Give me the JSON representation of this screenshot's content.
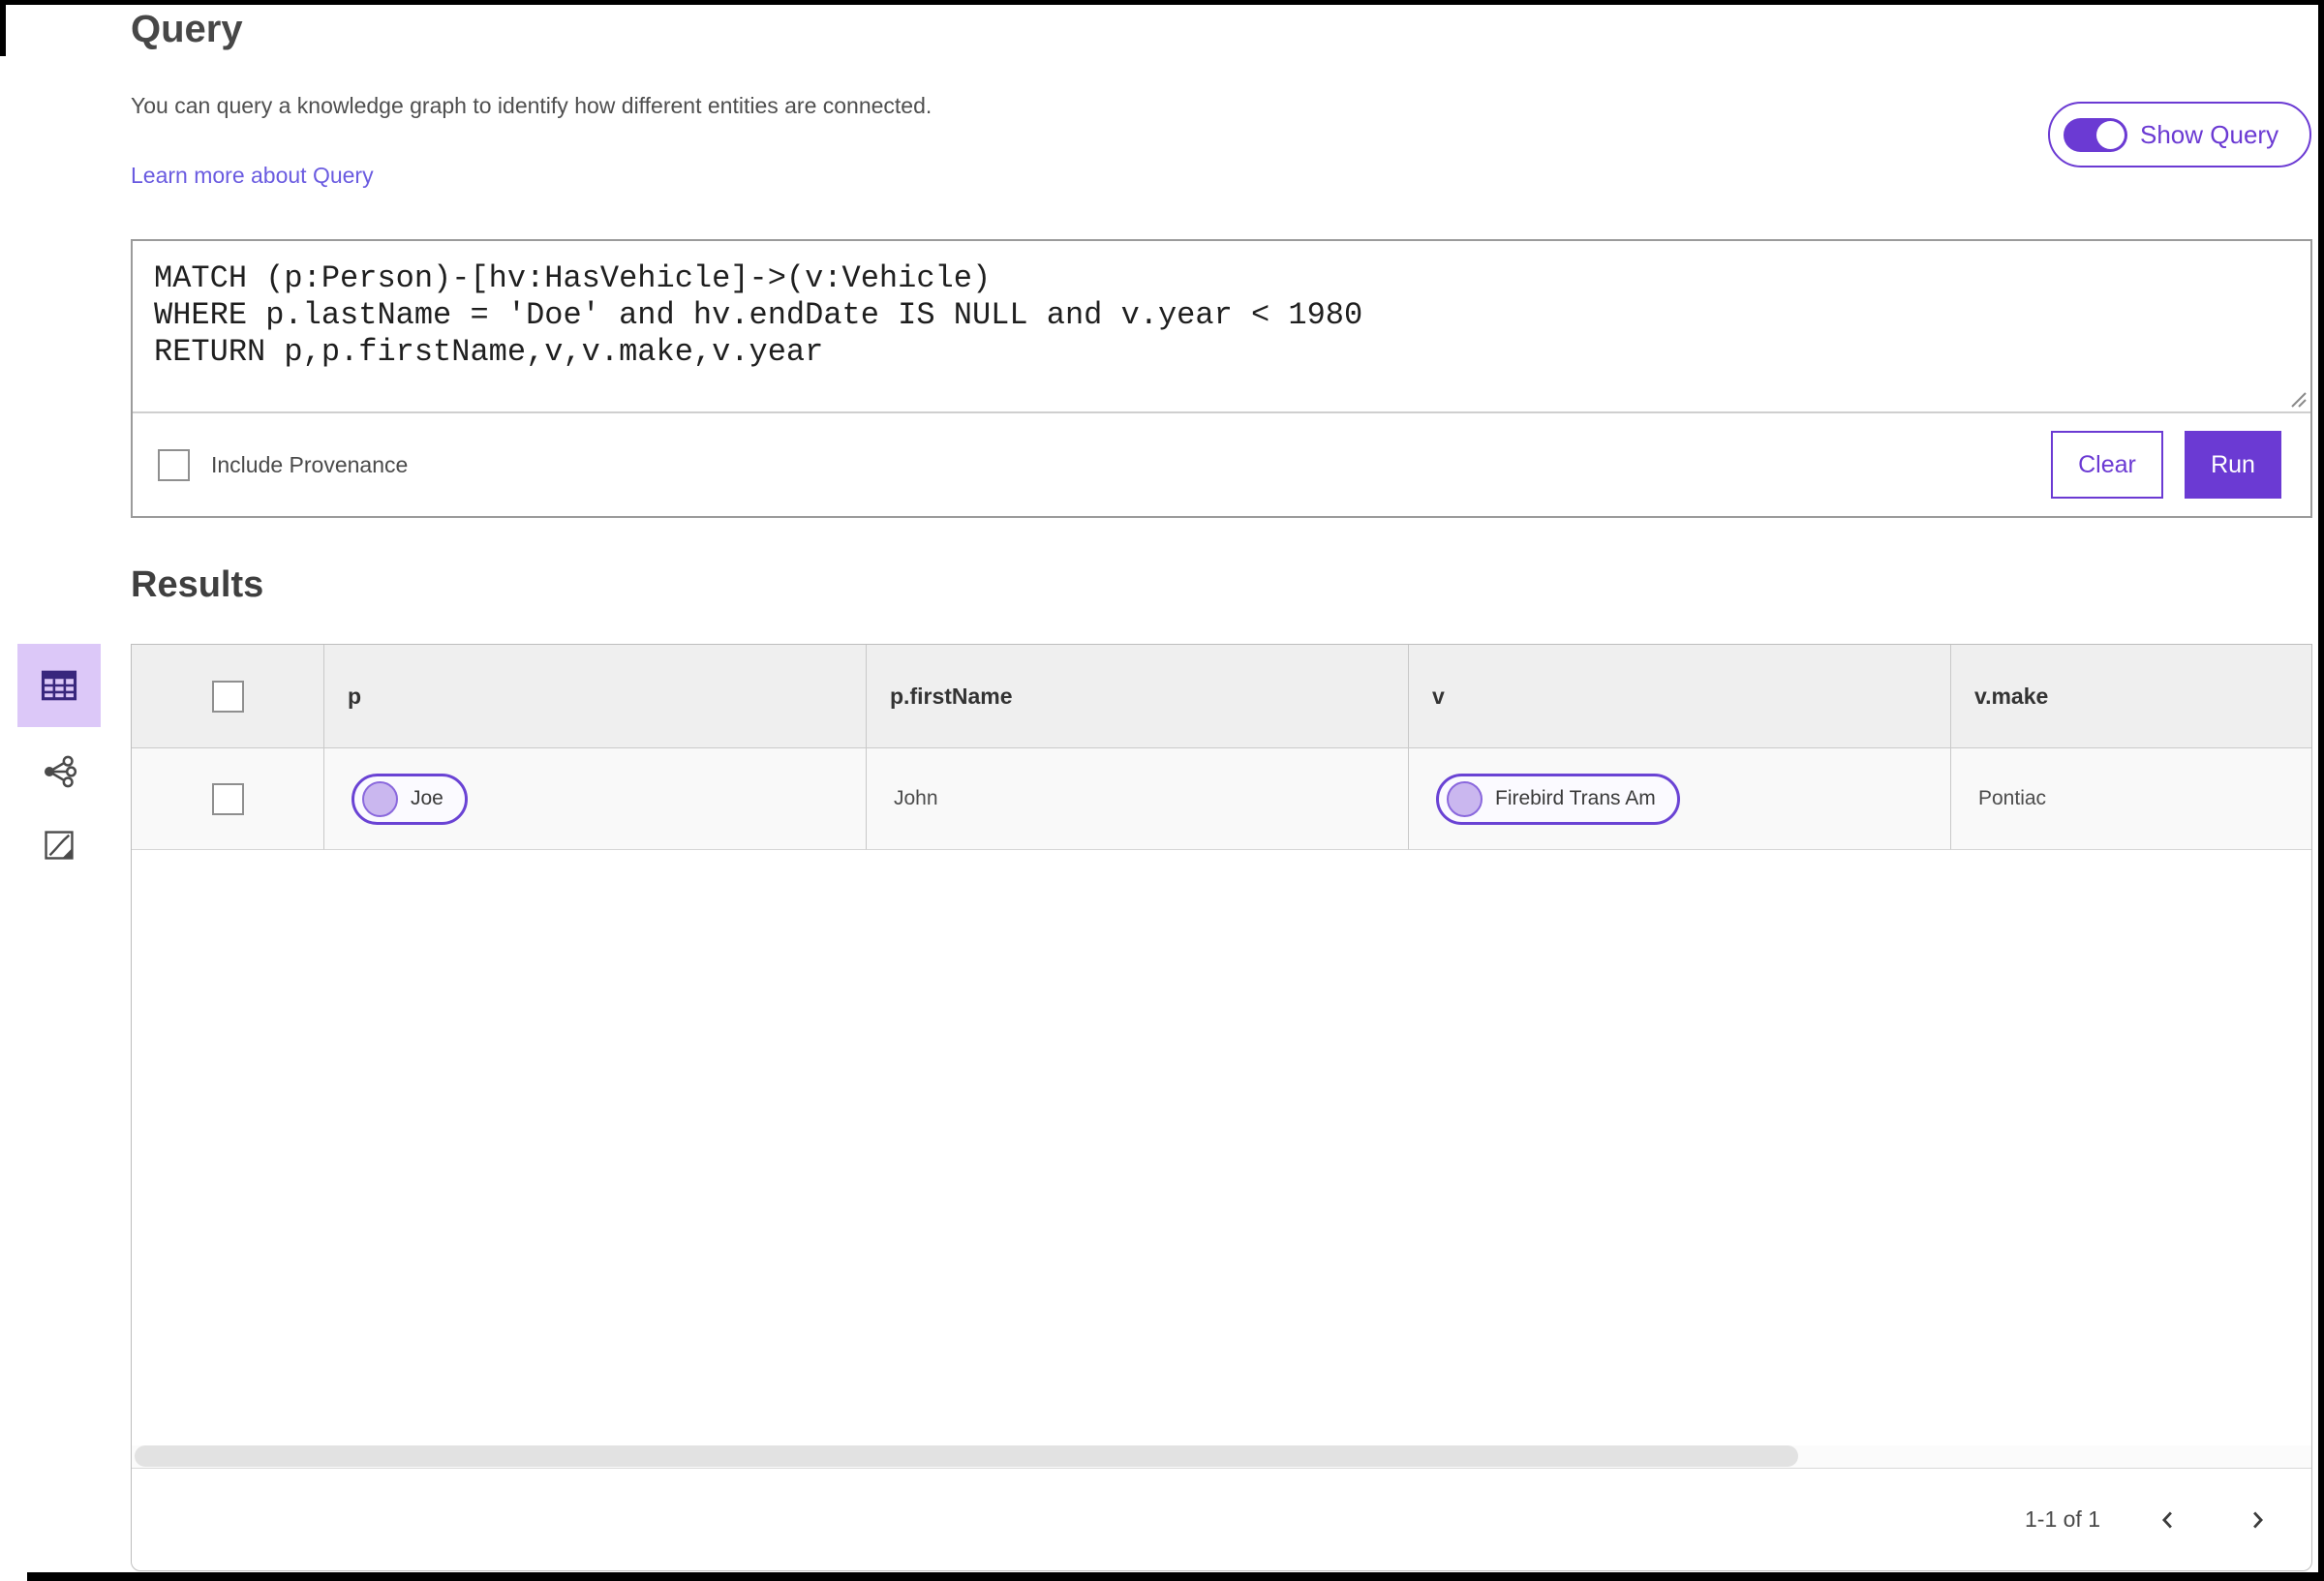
{
  "header": {
    "title": "Query",
    "description": "You can query a knowledge graph to identify how different entities are connected.",
    "learn_more_link": "Learn more about Query",
    "show_query_toggle": {
      "label": "Show Query",
      "state_on": true
    }
  },
  "query_editor": {
    "code": "MATCH (p:Person)-[hv:HasVehicle]->(v:Vehicle)\nWHERE p.lastName = 'Doe' and hv.endDate IS NULL and v.year < 1980\nRETURN p,p.firstName,v,v.make,v.year",
    "include_provenance": {
      "label": "Include Provenance",
      "checked": false
    },
    "clear_button": "Clear",
    "run_button": "Run"
  },
  "results": {
    "heading": "Results",
    "view_toolbar": [
      {
        "name": "table-view",
        "icon": "table-icon",
        "selected": true
      },
      {
        "name": "link-chart-view",
        "icon": "link-chart-icon",
        "selected": false
      },
      {
        "name": "map-view",
        "icon": "map-icon",
        "selected": false
      }
    ],
    "table": {
      "columns": [
        "p",
        "p.firstName",
        "v",
        "v.make"
      ],
      "rows": [
        {
          "selected": false,
          "p_chip": "Joe",
          "p_firstName": "John",
          "v_chip": "Firebird Trans Am",
          "v_make": "Pontiac"
        }
      ]
    },
    "pagination": {
      "range_label": "1-1 of 1"
    }
  },
  "colors": {
    "primary_purple": "#6b3ad3",
    "link_purple": "#6a5be0",
    "selected_tool_bg": "#dcc8f8",
    "chip_border": "#6a43d4",
    "chip_dot_fill": "#cab7ef",
    "table_header_bg": "#efefef",
    "run_button_bg": "#6b3ad3"
  }
}
